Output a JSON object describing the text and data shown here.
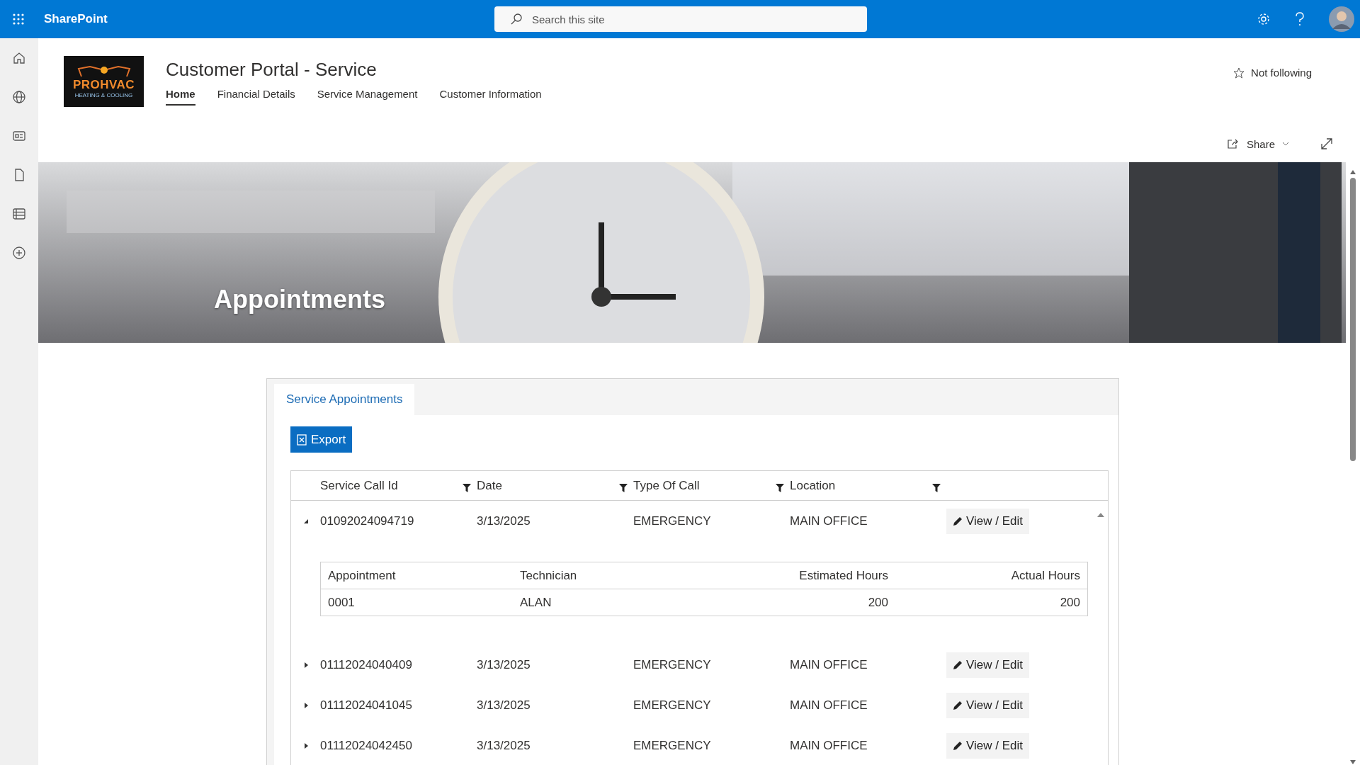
{
  "suite_bar": {
    "app_name": "SharePoint",
    "search": {
      "placeholder": "Search this site"
    }
  },
  "site_header": {
    "logo": {
      "brand": "PROHVAC",
      "tagline": "HEATING & COOLING"
    },
    "title": "Customer Portal - Service",
    "nav": [
      {
        "label": "Home",
        "selected": true
      },
      {
        "label": "Financial Details",
        "selected": false
      },
      {
        "label": "Service Management",
        "selected": false
      },
      {
        "label": "Customer Information",
        "selected": false
      }
    ],
    "follow": {
      "label": "Not following",
      "following": false
    }
  },
  "command_bar": {
    "share": "Share"
  },
  "hero": {
    "title": "Appointments"
  },
  "panel": {
    "tabs": [
      {
        "label": "Service Appointments",
        "selected": true
      }
    ],
    "export": "Export",
    "grid": {
      "columns": [
        "Service Call Id",
        "Date",
        "Type Of Call",
        "Location"
      ],
      "rows": [
        {
          "id": "01092024094719",
          "date": "3/13/2025",
          "type": "EMERGENCY",
          "location": "MAIN OFFICE",
          "action": "View / Edit",
          "expanded": true,
          "detail": {
            "columns": [
              "Appointment",
              "Technician",
              "Estimated Hours",
              "Actual Hours"
            ],
            "rows": [
              [
                "0001",
                "ALAN",
                "200",
                "200"
              ]
            ]
          }
        },
        {
          "id": "01112024040409",
          "date": "3/13/2025",
          "type": "EMERGENCY",
          "location": "MAIN OFFICE",
          "action": "View / Edit",
          "expanded": false
        },
        {
          "id": "01112024041045",
          "date": "3/13/2025",
          "type": "EMERGENCY",
          "location": "MAIN OFFICE",
          "action": "View / Edit",
          "expanded": false
        },
        {
          "id": "01112024042450",
          "date": "3/13/2025",
          "type": "EMERGENCY",
          "location": "MAIN OFFICE",
          "action": "View / Edit",
          "expanded": false
        }
      ]
    }
  }
}
